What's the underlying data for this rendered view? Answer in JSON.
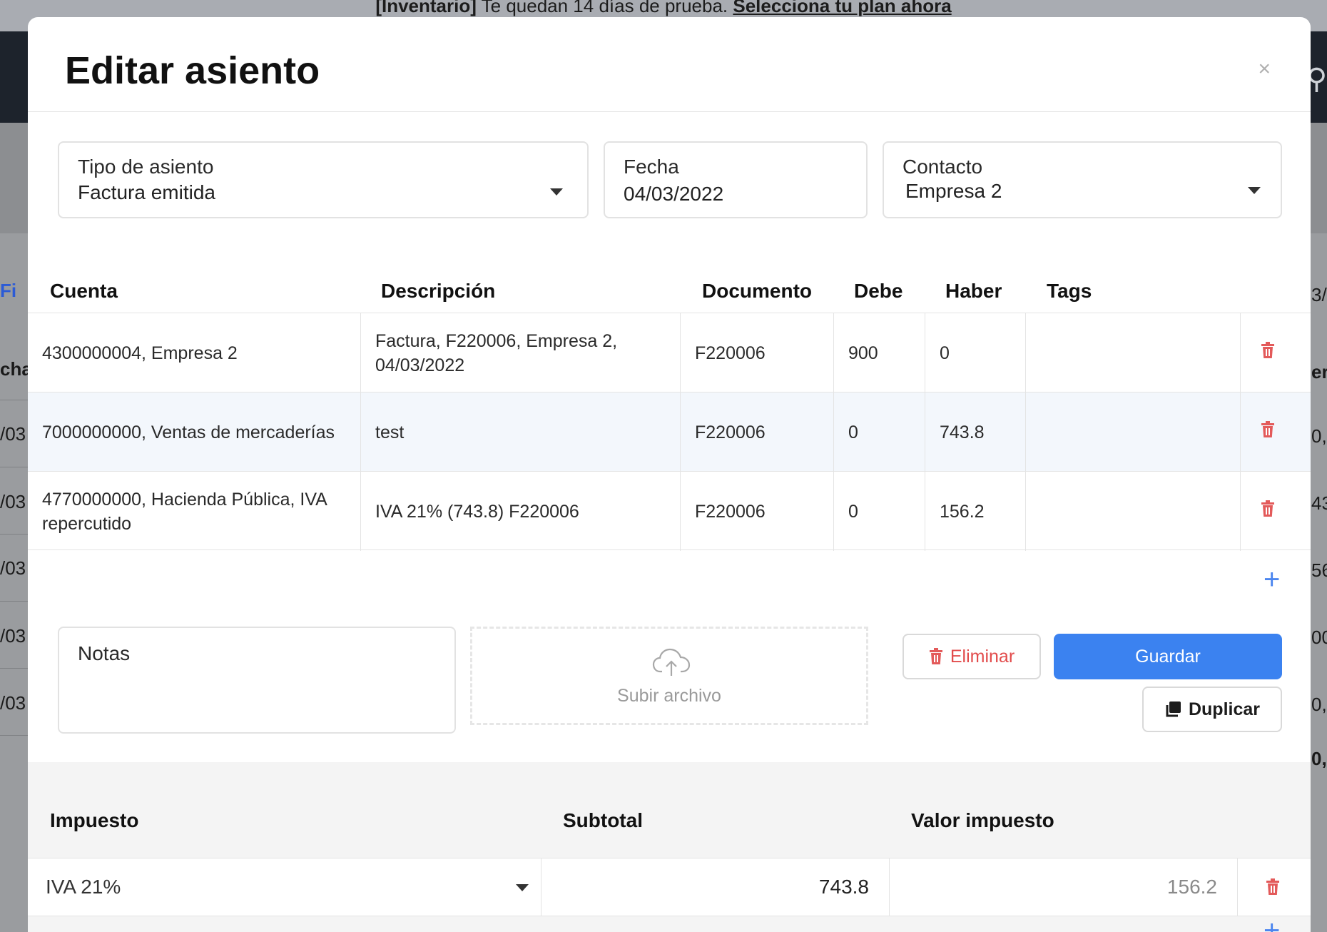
{
  "background": {
    "banner_tag": "[Inventario]",
    "banner_text": " Te quedan 14 días de prueba. ",
    "banner_link": "Selecciona tu plan ahora",
    "left_fragments": [
      "Fi",
      "cha",
      "/03",
      "/03",
      "/03",
      "/03",
      "/03"
    ],
    "right_fragments": [
      "3/",
      "er",
      "0,",
      "43,",
      "56,",
      "00,",
      "0,",
      "0,"
    ]
  },
  "modal": {
    "title": "Editar asiento",
    "close_label": "×",
    "fields": {
      "tipo": {
        "label": "Tipo de asiento",
        "value": "Factura emitida"
      },
      "fecha": {
        "label": "Fecha",
        "value": "04/03/2022"
      },
      "contacto": {
        "label": "Contacto",
        "value": "Empresa 2"
      }
    },
    "columns": [
      "Cuenta",
      "Descripción",
      "Documento",
      "Debe",
      "Haber",
      "Tags"
    ],
    "rows": [
      {
        "cuenta": "4300000004, Empresa 2",
        "descripcion": "Factura, F220006, Empresa 2, 04/03/2022",
        "documento": "F220006",
        "debe": "900",
        "haber": "0",
        "tags": ""
      },
      {
        "cuenta": "7000000000, Ventas de mercaderías",
        "descripcion": "test",
        "documento": "F220006",
        "debe": "0",
        "haber": "743.8",
        "tags": ""
      },
      {
        "cuenta": "4770000000, Hacienda Pública, IVA repercutido",
        "descripcion": "IVA 21% (743.8) F220006",
        "documento": "F220006",
        "debe": "0",
        "haber": "156.2",
        "tags": ""
      }
    ],
    "notes_label": "Notas",
    "upload_label": "Subir archivo",
    "buttons": {
      "delete": "Eliminar",
      "save": "Guardar",
      "duplicate": "Duplicar"
    },
    "tax": {
      "columns": [
        "Impuesto",
        "Subtotal",
        "Valor impuesto"
      ],
      "row": {
        "impuesto": "IVA 21%",
        "subtotal": "743.8",
        "valor": "156.2"
      }
    }
  },
  "colors": {
    "primary": "#3b82f0",
    "danger": "#e24b4b",
    "add": "#4c86ef"
  }
}
